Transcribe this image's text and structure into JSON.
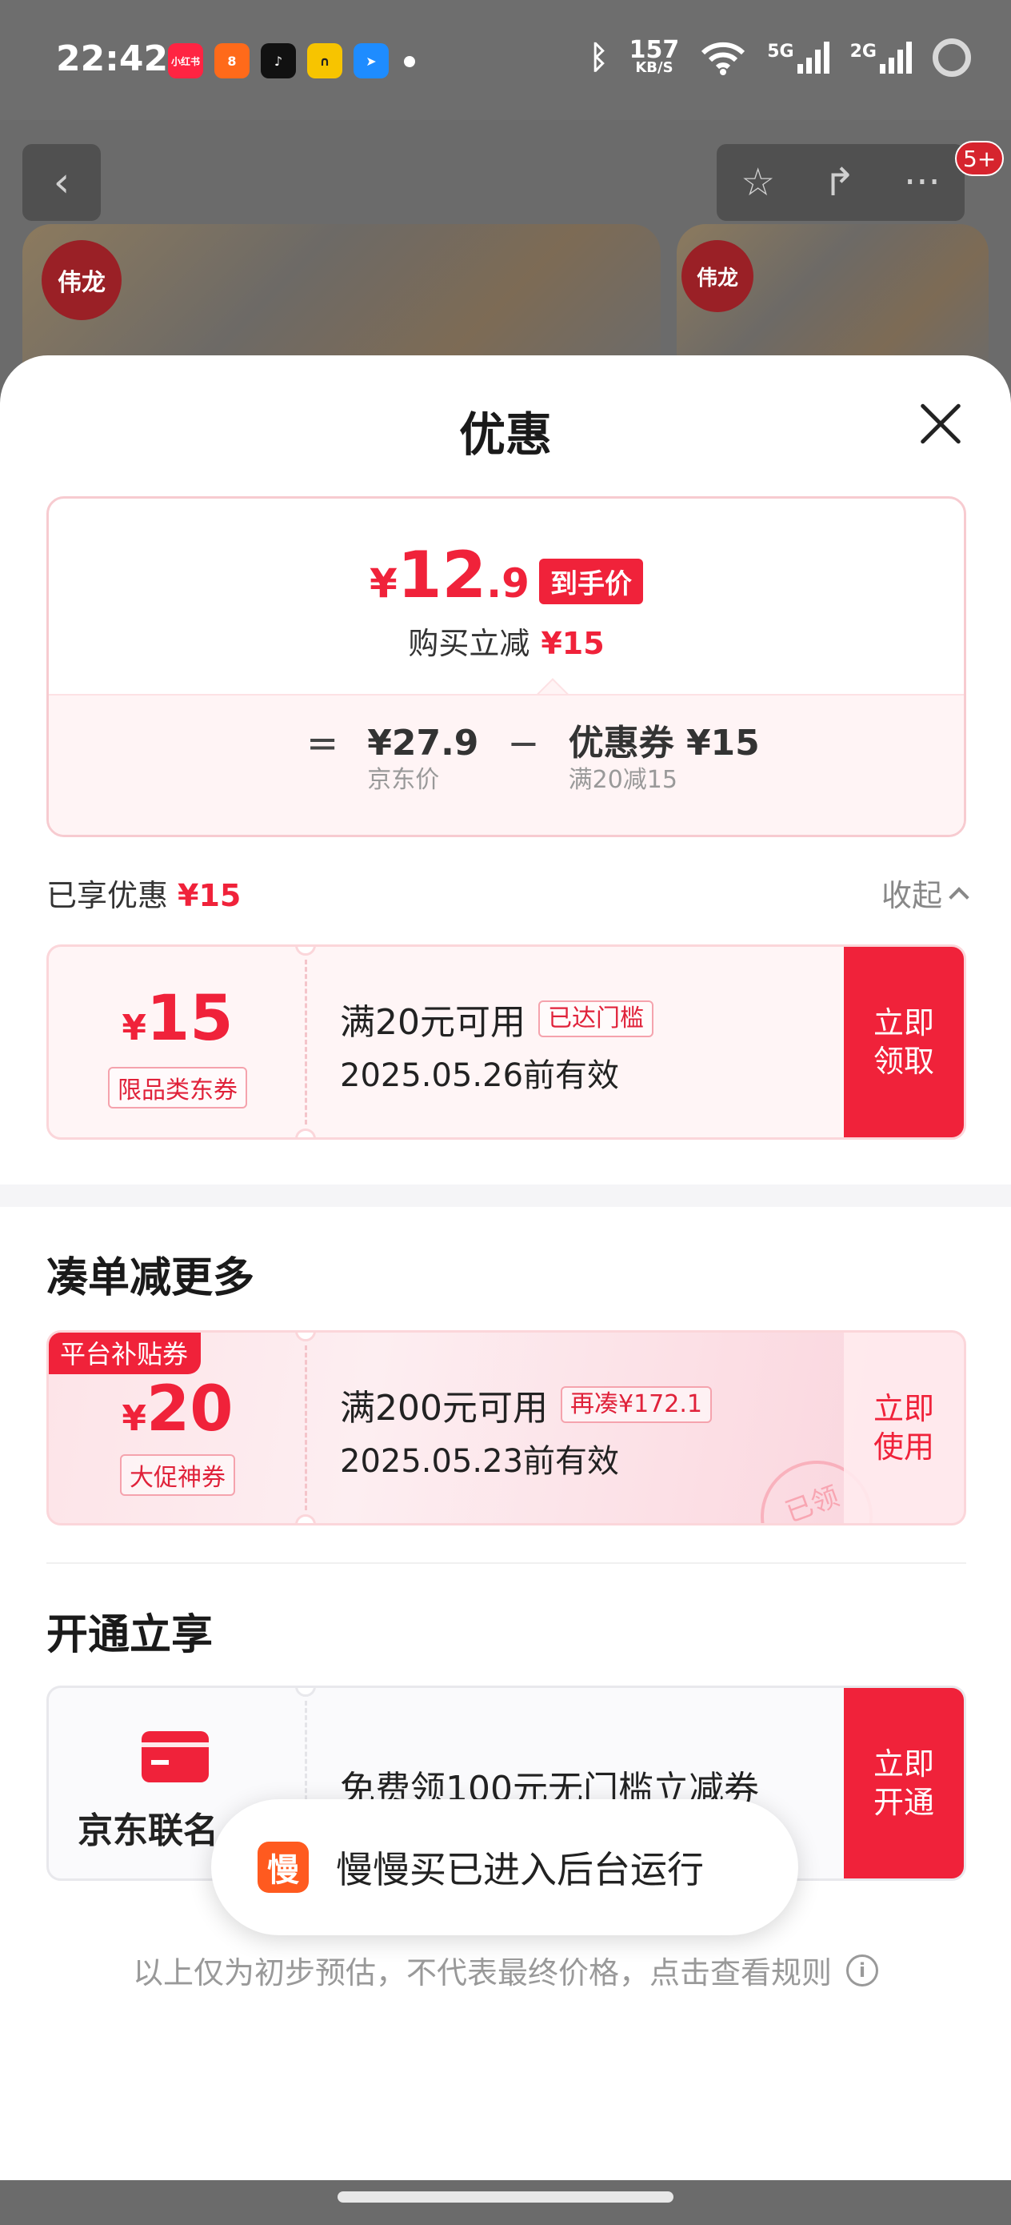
{
  "status_bar": {
    "time": "22:42",
    "app_icons": [
      {
        "name": "xiaohongshu-icon",
        "label": "小红书",
        "color": "#ff2442"
      },
      {
        "name": "kuaishou-icon",
        "label": "8",
        "color": "#ff6a1a"
      },
      {
        "name": "douyin-icon",
        "label": "♪",
        "color": "#111111"
      },
      {
        "name": "app-yellow-icon",
        "label": "∩",
        "color": "#f7c400"
      },
      {
        "name": "app-blue-icon",
        "label": "➤",
        "color": "#1e8cff"
      }
    ],
    "net_speed": "157",
    "net_unit": "KB/S",
    "sim1": "5G",
    "sim2": "2G"
  },
  "background_page": {
    "back_glyph": "‹",
    "star_glyph": "☆",
    "share_glyph": "↱",
    "more_glyph": "···",
    "badge": "5+",
    "brand_logo": "伟龙"
  },
  "sheet": {
    "title": "优惠",
    "price_card": {
      "currency": "¥",
      "price_int": "12",
      "price_dec": ".9",
      "final_tag": "到手价",
      "reduce_label": "购买立减",
      "reduce_amount": "¥15",
      "eq": "=",
      "minus": "−",
      "jd_price": "¥27.9",
      "jd_price_label": "京东价",
      "coupon_value": "优惠券 ¥15",
      "coupon_rule": "满20减15"
    },
    "enjoyed": {
      "label": "已享优惠",
      "amount": "¥15",
      "collapse": "收起"
    },
    "coupon1": {
      "currency": "¥",
      "amount": "15",
      "type": "限品类东券",
      "condition": "满20元可用",
      "status": "已达门槛",
      "expiry": "2025.05.26前有效",
      "button": "立即\n领取"
    },
    "section_more": "凑单减更多",
    "coupon2": {
      "tag": "平台补贴券",
      "currency": "¥",
      "amount": "20",
      "type": "大促神券",
      "condition": "满200元可用",
      "status": "再凑¥172.1",
      "expiry": "2025.05.23前有效",
      "stamp": "已领",
      "button": "立即\n使用"
    },
    "section_open": "开通立享",
    "member": {
      "name": "京东联名",
      "desc": "免费领100元无门槛立减券",
      "button": "立即\n开通"
    },
    "toast": {
      "logo": "慢",
      "text": "慢慢买已进入后台运行"
    },
    "footnote": "以上仅为初步预估，不代表最终价格，点击查看规则",
    "info_glyph": "i"
  },
  "colors": {
    "accent_red": "#f0223a",
    "overlay_gray": "#6b6b6b"
  }
}
